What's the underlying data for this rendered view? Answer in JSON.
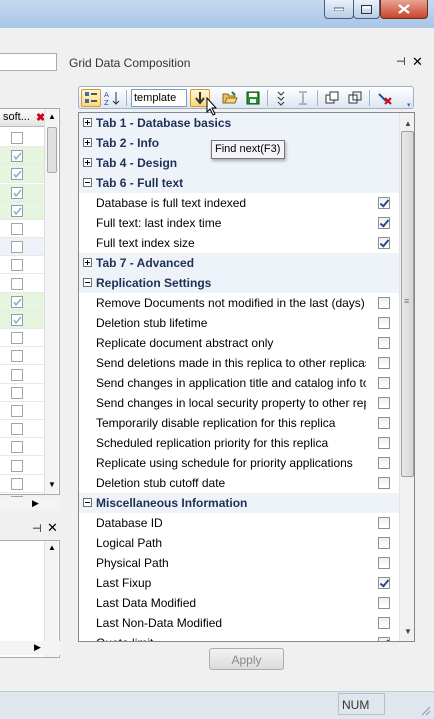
{
  "window": {
    "minimize_icon": "minimize-icon",
    "maximize_icon": "maximize-icon",
    "close_icon": "close-icon"
  },
  "left_panel": {
    "header_label": "soft...",
    "checkboxes": [
      {
        "checked": false,
        "color": "white"
      },
      {
        "checked": true,
        "color": "green"
      },
      {
        "checked": true,
        "color": "green"
      },
      {
        "checked": true,
        "color": "green"
      },
      {
        "checked": true,
        "color": "green"
      },
      {
        "checked": false,
        "color": "white"
      },
      {
        "checked": false,
        "color": "blue"
      },
      {
        "checked": false,
        "color": "white"
      },
      {
        "checked": false,
        "color": "white"
      },
      {
        "checked": true,
        "color": "green"
      },
      {
        "checked": true,
        "color": "green"
      },
      {
        "checked": false,
        "color": "white"
      },
      {
        "checked": false,
        "color": "white"
      },
      {
        "checked": false,
        "color": "white"
      },
      {
        "checked": false,
        "color": "white"
      },
      {
        "checked": false,
        "color": "white"
      },
      {
        "checked": false,
        "color": "white"
      },
      {
        "checked": false,
        "color": "white"
      },
      {
        "checked": false,
        "color": "white"
      },
      {
        "checked": false,
        "color": "white"
      },
      {
        "checked": false,
        "color": "white"
      }
    ]
  },
  "panel": {
    "title": "Grid Data Composition",
    "search_value": "template",
    "tooltip": "Find next(F3)",
    "apply_label": "Apply"
  },
  "grid_rows": [
    {
      "type": "cat",
      "expanded": false,
      "label": "Tab 1 - Database basics"
    },
    {
      "type": "cat",
      "expanded": false,
      "label": "Tab 2 - Info"
    },
    {
      "type": "cat",
      "expanded": false,
      "label": "Tab 4 - Design"
    },
    {
      "type": "cat",
      "expanded": true,
      "label": "Tab 6 - Full text"
    },
    {
      "type": "prop",
      "label": "Database is full text indexed",
      "checked": true
    },
    {
      "type": "prop",
      "label": "Full text: last index time",
      "checked": true
    },
    {
      "type": "prop",
      "label": "Full text index size",
      "checked": true
    },
    {
      "type": "cat",
      "expanded": false,
      "label": "Tab 7 - Advanced"
    },
    {
      "type": "cat",
      "expanded": true,
      "label": "Replication Settings"
    },
    {
      "type": "prop",
      "label": "Remove Documents not modified in the last (days)",
      "checked": false
    },
    {
      "type": "prop",
      "label": "Deletion stub lifetime",
      "checked": false
    },
    {
      "type": "prop",
      "label": "Replicate document abstract only",
      "checked": false
    },
    {
      "type": "prop",
      "label": "Send deletions made in this replica to other replicas",
      "checked": false
    },
    {
      "type": "prop",
      "label": "Send changes in application title and catalog info to",
      "checked": false
    },
    {
      "type": "prop",
      "label": "Send changes in local security property to other rep",
      "checked": false
    },
    {
      "type": "prop",
      "label": "Temporarily disable replication for this replica",
      "checked": false
    },
    {
      "type": "prop",
      "label": "Scheduled replication priority for this replica",
      "checked": false
    },
    {
      "type": "prop",
      "label": "Replicate using schedule for priority applications",
      "checked": false
    },
    {
      "type": "prop",
      "label": "Deletion stub cutoff date",
      "checked": false
    },
    {
      "type": "cat",
      "expanded": true,
      "label": "Miscellaneous Information"
    },
    {
      "type": "prop",
      "label": "Database ID",
      "checked": false
    },
    {
      "type": "prop",
      "label": "Logical Path",
      "checked": false
    },
    {
      "type": "prop",
      "label": "Physical Path",
      "checked": false
    },
    {
      "type": "prop",
      "label": "Last Fixup",
      "checked": true
    },
    {
      "type": "prop",
      "label": "Last Data Modified",
      "checked": false
    },
    {
      "type": "prop",
      "label": "Last Non-Data Modified",
      "checked": false
    },
    {
      "type": "prop",
      "label": "Quota limit",
      "checked": true
    }
  ],
  "statusbar": {
    "num_label": "NUM"
  }
}
